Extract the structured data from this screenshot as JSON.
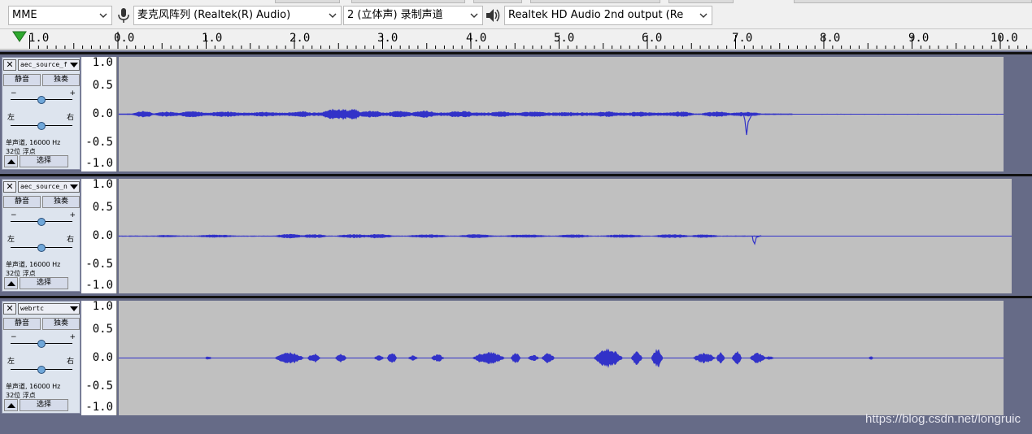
{
  "device_toolbar": {
    "host": "MME",
    "recording_device": "麦克风阵列 (Realtek(R) Audio)",
    "recording_channels": "2 (立体声) 录制声道",
    "playback_device": "Realtek HD Audio 2nd output (Re"
  },
  "timeline": {
    "labels": [
      "1.0",
      "0.0",
      "1.0",
      "2.0",
      "3.0",
      "4.0",
      "5.0",
      "6.0",
      "7.0",
      "8.0",
      "9.0",
      "10.0"
    ]
  },
  "tracks": [
    {
      "name": "aec_source_f",
      "mute_label": "静音",
      "solo_label": "独奏",
      "gain_minus": "−",
      "gain_plus": "+",
      "pan_left": "左",
      "pan_right": "右",
      "info_line1": "单声道, 16000 Hz",
      "info_line2": "32位 浮点",
      "select_label": "选择",
      "scale": [
        "1.0",
        "0.5",
        "0.0",
        "-0.5",
        "-1.0"
      ],
      "gain": 0.5,
      "pan": 0.5
    },
    {
      "name": "aec_source_n",
      "mute_label": "静音",
      "solo_label": "独奏",
      "gain_minus": "−",
      "gain_plus": "+",
      "pan_left": "左",
      "pan_right": "右",
      "info_line1": "单声道, 16000 Hz",
      "info_line2": "32位 浮点",
      "select_label": "选择",
      "scale": [
        "1.0",
        "0.5",
        "0.0",
        "-0.5",
        "-1.0"
      ],
      "gain": 0.5,
      "pan": 0.5
    },
    {
      "name": "webrtc",
      "mute_label": "静音",
      "solo_label": "独奏",
      "gain_minus": "−",
      "gain_plus": "+",
      "pan_left": "左",
      "pan_right": "右",
      "info_line1": "单声道, 16000 Hz",
      "info_line2": "32位 浮点",
      "select_label": "选择",
      "scale": [
        "1.0",
        "0.5",
        "0.0",
        "-0.5",
        "-1.0"
      ],
      "gain": 0.5,
      "pan": 0.5
    }
  ],
  "watermark": "https://blog.csdn.net/longruic",
  "colors": {
    "wave_fill": "#3232c8",
    "wave_bg": "#c0c0c0",
    "track_bg": "#666b87",
    "ctrl_bg": "#dde4ee",
    "play_marker": "#2ea82e"
  },
  "icons": {
    "close": "close-icon",
    "dropdown": "triangle-down-icon",
    "collapse": "triangle-up-icon",
    "mic": "microphone-icon",
    "speaker": "speaker-icon",
    "play_marker": "play-marker-icon"
  }
}
